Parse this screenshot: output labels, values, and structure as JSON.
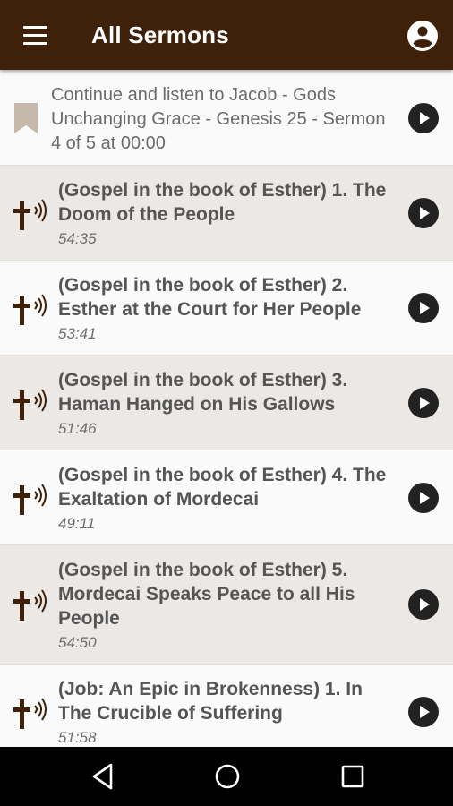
{
  "header": {
    "title": "All Sermons",
    "menu_icon": "menu-icon",
    "account_icon": "account-circle-icon"
  },
  "continue": {
    "text": "Continue and listen to Jacob - Gods Unchanging Grace - Genesis 25 - Sermon 4 of 5 at 00:00",
    "icon": "bookmark-icon"
  },
  "sermons": [
    {
      "title": "(Gospel in the book of Esther) 1. The Doom of the People",
      "duration": "54:35"
    },
    {
      "title": "(Gospel in the book of Esther) 2. Esther at the Court for Her People",
      "duration": "53:41"
    },
    {
      "title": "(Gospel in the book of Esther) 3. Haman Hanged on His Gallows",
      "duration": "51:46"
    },
    {
      "title": "(Gospel in the book of Esther) 4. The Exaltation of Mordecai",
      "duration": "49:11"
    },
    {
      "title": "(Gospel in the book of Esther) 5. Mordecai Speaks Peace to all His People",
      "duration": "54:50"
    },
    {
      "title": "(Job: An Epic in Brokenness) 1. In The Crucible of Suffering",
      "duration": "51:58"
    }
  ],
  "colors": {
    "appbar": "#3e2108",
    "cross": "#3e2108",
    "play": "#222222"
  },
  "navbar": {
    "back_icon": "nav-back-icon",
    "home_icon": "nav-home-icon",
    "recent_icon": "nav-recent-apps-icon"
  }
}
